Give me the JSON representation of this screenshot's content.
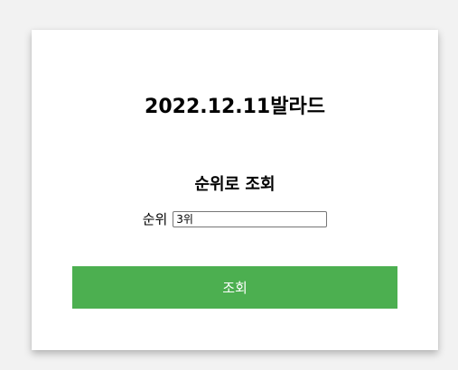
{
  "page": {
    "title": "2022.12.11발라드"
  },
  "form": {
    "section_title": "순위로 조회",
    "rank_label": "순위",
    "rank_value": "3위",
    "submit_label": "조회"
  }
}
